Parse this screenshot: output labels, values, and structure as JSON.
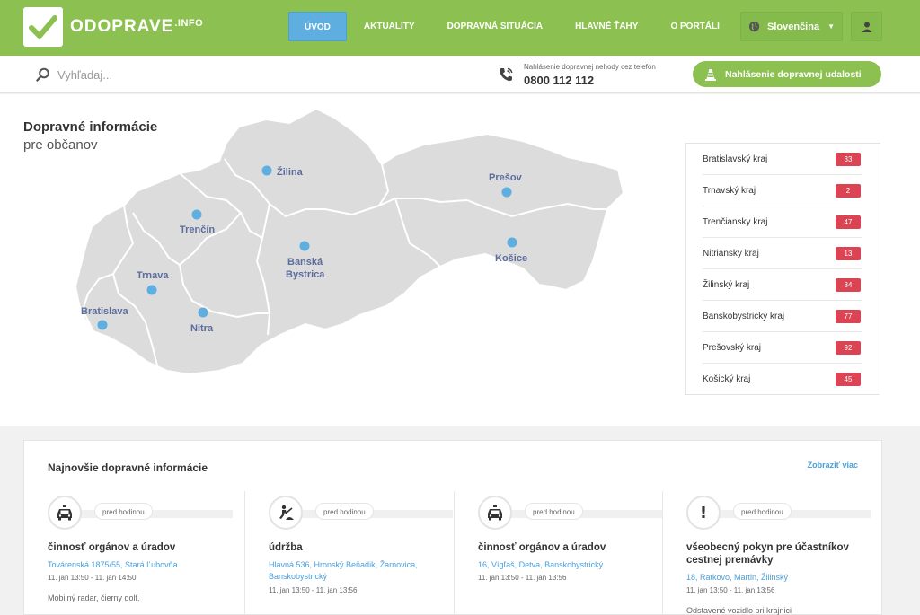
{
  "brand": {
    "logo_text": "ODOPRAVE",
    "logo_sup": ".INFO"
  },
  "nav": [
    {
      "label": "ÚVOD",
      "active": true
    },
    {
      "label": "AKTUALITY",
      "active": false
    },
    {
      "label": "DOPRAVNÁ SITUÁCIA",
      "active": false
    },
    {
      "label": "HLAVNÉ ŤAHY",
      "active": false
    },
    {
      "label": "O PORTÁLI",
      "active": false
    }
  ],
  "language": {
    "selected": "Slovenčina"
  },
  "search": {
    "placeholder": "Vyhľadaj..."
  },
  "phone": {
    "label": "Nahlásenie dopravnej nehody cez telefón",
    "number": "0800 112 112"
  },
  "report_button": {
    "label": "Nahlásenie dopravnej udalosti"
  },
  "map": {
    "title": "Dopravné informácie",
    "subtitle": "pre občanov",
    "cities": [
      "Žilina",
      "Prešov",
      "Trenčín",
      "Banská",
      "Bystrica",
      "Košice",
      "Trnava",
      "Bratislava",
      "Nitra"
    ]
  },
  "regions": [
    {
      "name": "Bratislavský kraj",
      "count": "33"
    },
    {
      "name": "Trnavský kraj",
      "count": "2"
    },
    {
      "name": "Trenčiansky kraj",
      "count": "47"
    },
    {
      "name": "Nitriansky kraj",
      "count": "13"
    },
    {
      "name": "Žilinský kraj",
      "count": "84"
    },
    {
      "name": "Banskobystrický kraj",
      "count": "77"
    },
    {
      "name": "Prešovský kraj",
      "count": "92"
    },
    {
      "name": "Košický kraj",
      "count": "45"
    }
  ],
  "news": {
    "title": "Najnovšie dopravné informácie",
    "more": "Zobraziť viac",
    "items": [
      {
        "icon": "police-car-icon",
        "time": "pred hodinou",
        "category": "činnosť orgánov a úradov",
        "location": "Továrenská 1875/55, Stará Ľubovňa",
        "date": "11. jan 13:50 - 11. jan 14:50",
        "desc": "Mobilný radar, čierny golf."
      },
      {
        "icon": "road-work-icon",
        "time": "pred hodinou",
        "category": "údržba",
        "location": "Hlavná 536, Hronský Beňadik, Žarnovica, Banskobystrický",
        "date": "11. jan 13:50 - 11. jan 13:56",
        "desc": ""
      },
      {
        "icon": "police-car-icon",
        "time": "pred hodinou",
        "category": "činnosť orgánov a úradov",
        "location": "16, Vígľaš, Detva, Banskobystrický",
        "date": "11. jan 13:50 - 11. jan 13:56",
        "desc": ""
      },
      {
        "icon": "warning-icon",
        "time": "pred hodinou",
        "category": "všeobecný pokyn pre účastníkov cestnej premávky",
        "location": "18, Ratkovo, Martin, Žilinský",
        "date": "11. jan 13:50 - 11. jan 13:56",
        "desc": "Odstavené vozidlo pri krajnici"
      }
    ]
  },
  "colors": {
    "brand_green": "#8cc152",
    "accent_blue": "#5eaee0",
    "badge_red": "#da4453",
    "link_blue": "#4a9fd8"
  }
}
